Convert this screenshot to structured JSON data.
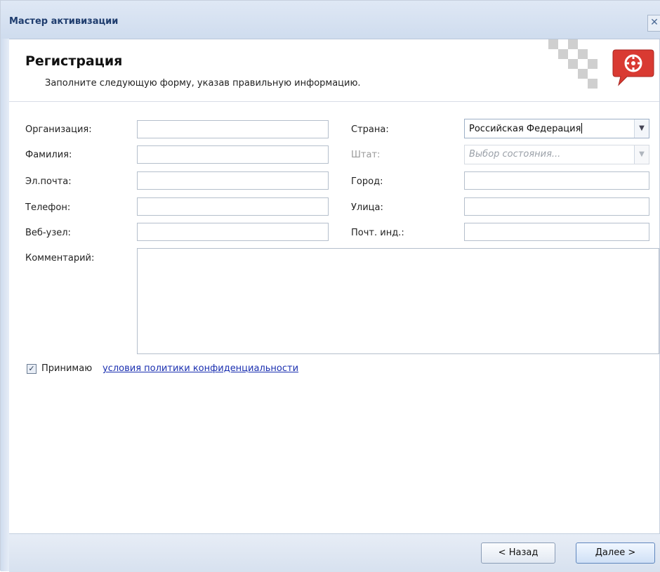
{
  "window": {
    "title": "Мастер активизации"
  },
  "header": {
    "heading": "Регистрация",
    "subheading": "Заполните следующую форму, указав правильную информацию."
  },
  "form": {
    "left": {
      "organization_label": "Организация:",
      "lastname_label": "Фамилия:",
      "email_label": "Эл.почта:",
      "phone_label": "Телефон:",
      "website_label": "Веб-узел:",
      "comment_label": "Комментарий:"
    },
    "right": {
      "country_label": "Страна:",
      "country_value": "Российская Федерация",
      "state_label": "Штат:",
      "state_placeholder": "Выбор состояния...",
      "city_label": "Город:",
      "street_label": "Улица:",
      "zip_label": "Почт. инд.:"
    }
  },
  "agreement": {
    "checked": true,
    "accept_text": "Принимаю",
    "policy_link": "условия политики конфиденциальности"
  },
  "footer": {
    "back_label": "< Назад",
    "next_label": "Далее >"
  },
  "colors": {
    "titlebar_text": "#1f3d6e",
    "link": "#1a2fb0",
    "logo_red": "#d93a32"
  }
}
